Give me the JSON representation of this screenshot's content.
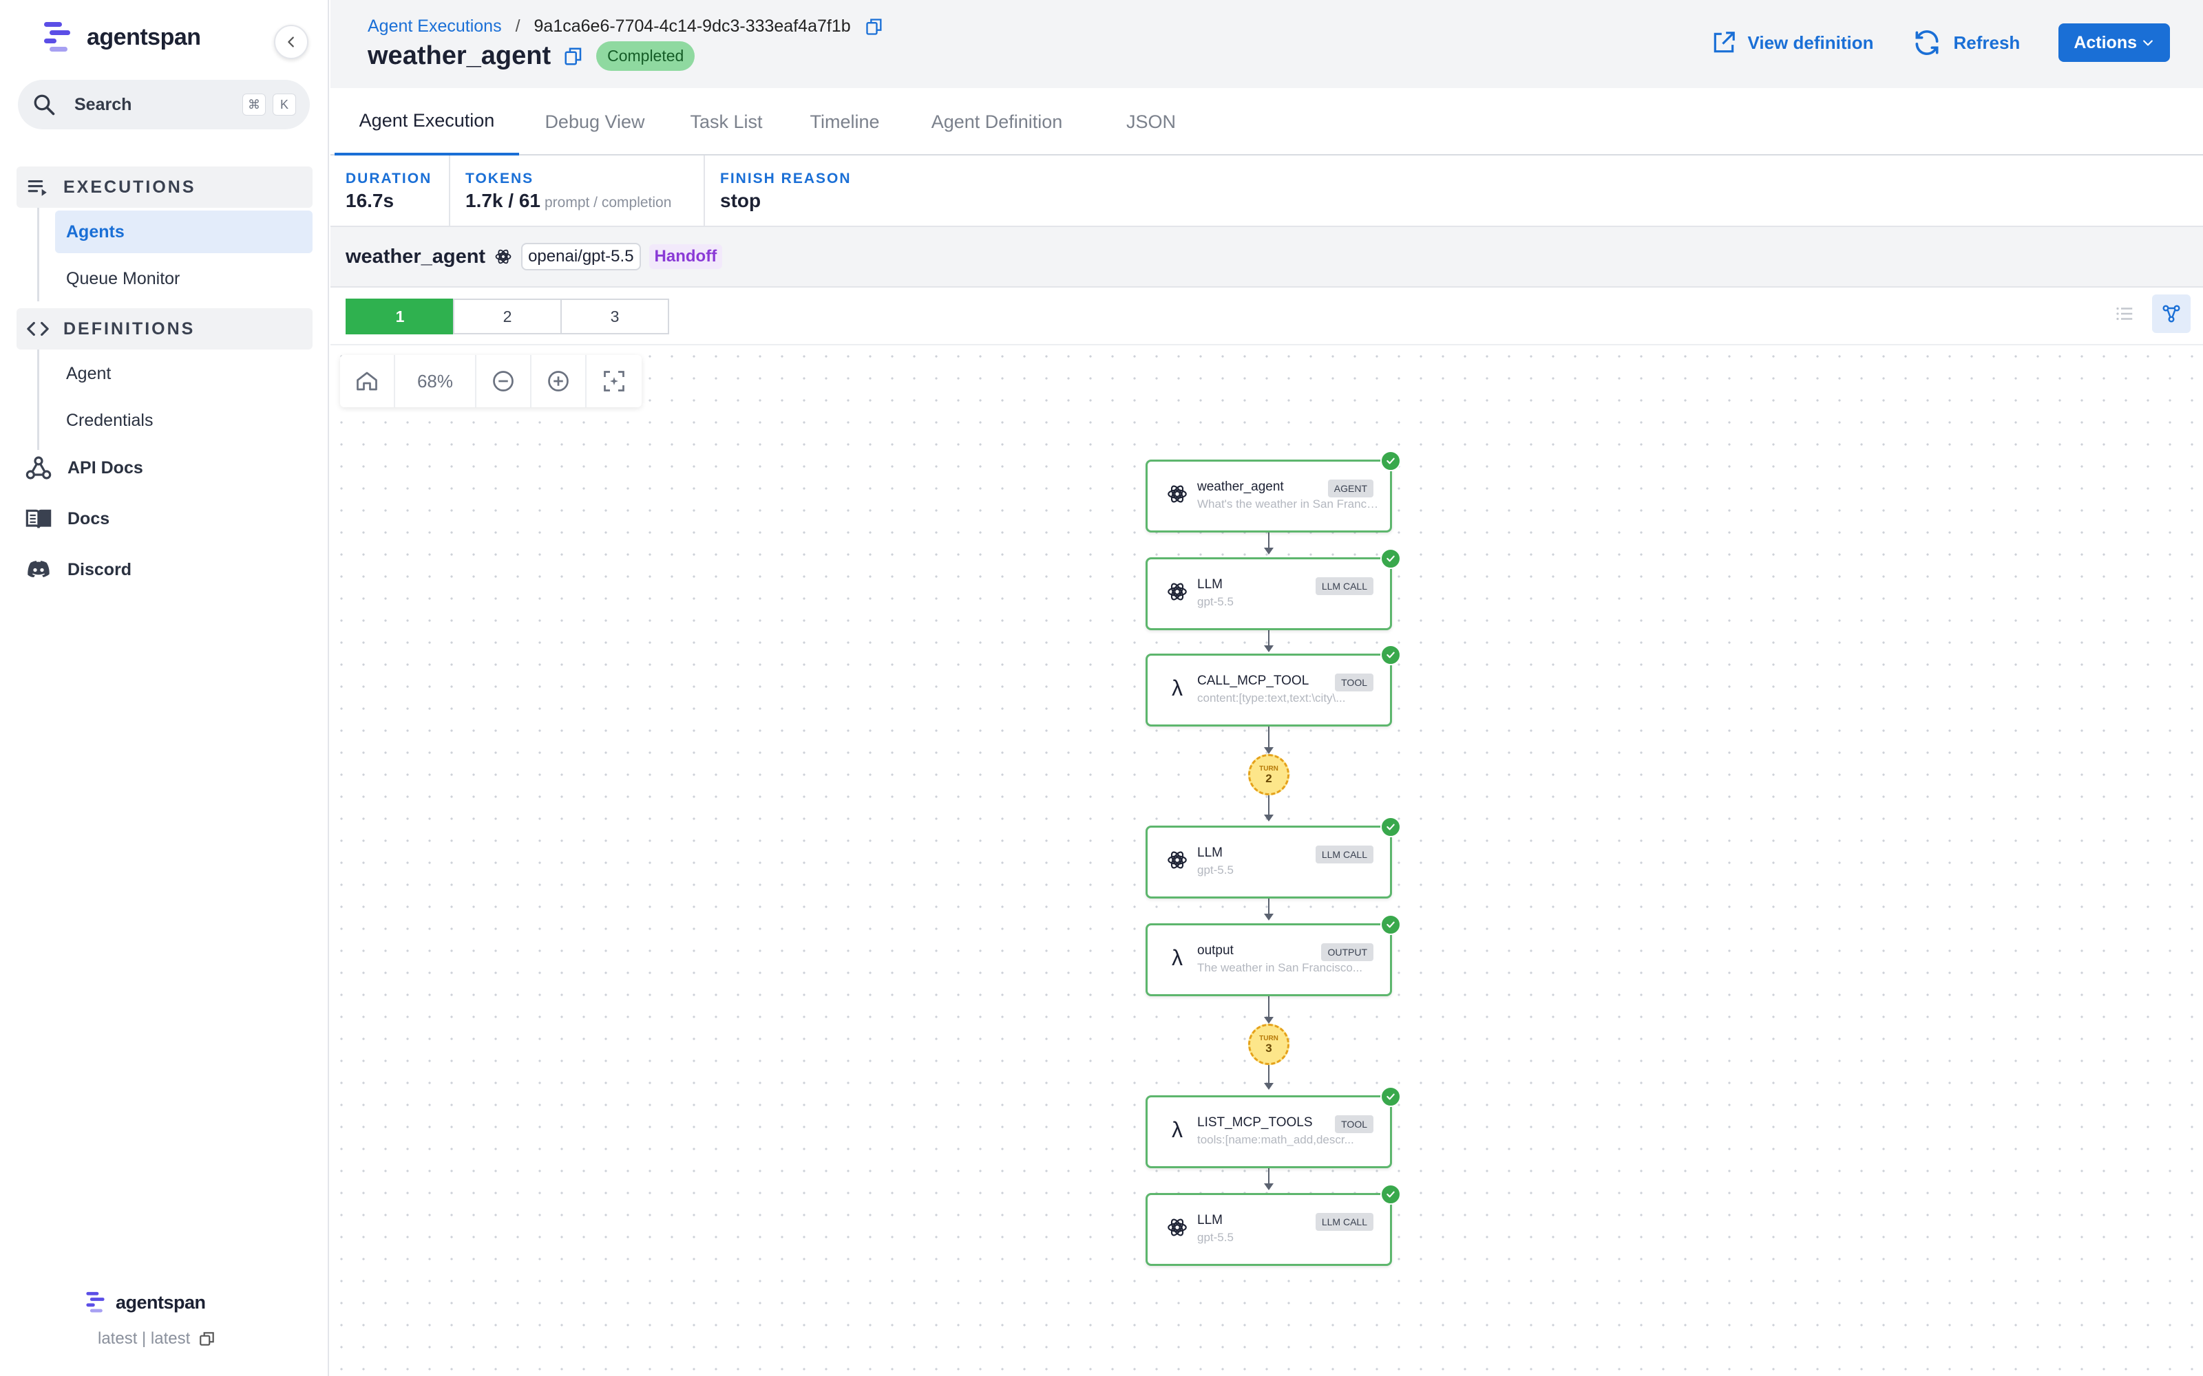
{
  "sidebar": {
    "logo_text": "agentspan",
    "search_label": "Search",
    "shortcut": [
      "⌘",
      "K"
    ],
    "executions_label": "EXECUTIONS",
    "executions_items": [
      "Agents",
      "Queue Monitor"
    ],
    "definitions_label": "DEFINITIONS",
    "definitions_items": [
      "Agent",
      "Credentials"
    ],
    "links": [
      "API Docs",
      "Docs",
      "Discord"
    ],
    "footer_logo": "agentspan",
    "version": "latest | latest"
  },
  "header": {
    "breadcrumb_parent": "Agent Executions",
    "breadcrumb_sep": "/",
    "execution_id": "9a1ca6e6-7704-4c14-9dc3-333eaf4a7f1b",
    "title": "weather_agent",
    "status": "Completed",
    "view_definition": "View definition",
    "refresh": "Refresh",
    "actions": "Actions"
  },
  "tabs": [
    "Agent Execution",
    "Debug View",
    "Task List",
    "Timeline",
    "Agent Definition",
    "JSON"
  ],
  "metrics": {
    "duration_label": "DURATION",
    "duration_value": "16.7s",
    "tokens_label": "TOKENS",
    "tokens_value": "1.7k / 61",
    "tokens_sub": "prompt / completion",
    "finish_label": "FINISH REASON",
    "finish_value": "stop"
  },
  "agent_bar": {
    "name": "weather_agent",
    "model": "openai/gpt-5.5",
    "tag": "Handoff"
  },
  "turn_tabs": [
    "1",
    "2",
    "3"
  ],
  "zoom": "68%",
  "colors": {
    "accent": "#1a6fd6",
    "success": "#2fb14f",
    "node_border": "#5db66d",
    "handoff": "#8a3ad6",
    "turn_marker": "#fde68a"
  },
  "graph": {
    "nodes": [
      {
        "icon": "openai-icon",
        "title": "weather_agent",
        "type": "AGENT",
        "subtitle": "What's the weather in San Francisco?"
      },
      {
        "icon": "openai-icon",
        "title": "LLM",
        "type": "LLM CALL",
        "subtitle": "gpt-5.5"
      },
      {
        "icon": "lambda-icon",
        "title": "CALL_MCP_TOOL",
        "type": "TOOL",
        "subtitle": "content:[type:text,text:\\city\\..."
      },
      {
        "icon": "openai-icon",
        "title": "LLM",
        "type": "LLM CALL",
        "subtitle": "gpt-5.5"
      },
      {
        "icon": "lambda-icon",
        "title": "output",
        "type": "OUTPUT",
        "subtitle": "The weather in San Francisco..."
      },
      {
        "icon": "lambda-icon",
        "title": "LIST_MCP_TOOLS",
        "type": "TOOL",
        "subtitle": "tools:[name:math_add,descr..."
      },
      {
        "icon": "openai-icon",
        "title": "LLM",
        "type": "LLM CALL",
        "subtitle": "gpt-5.5"
      }
    ],
    "turn_markers": [
      {
        "label": "TURN",
        "number": "2"
      },
      {
        "label": "TURN",
        "number": "3"
      }
    ]
  }
}
